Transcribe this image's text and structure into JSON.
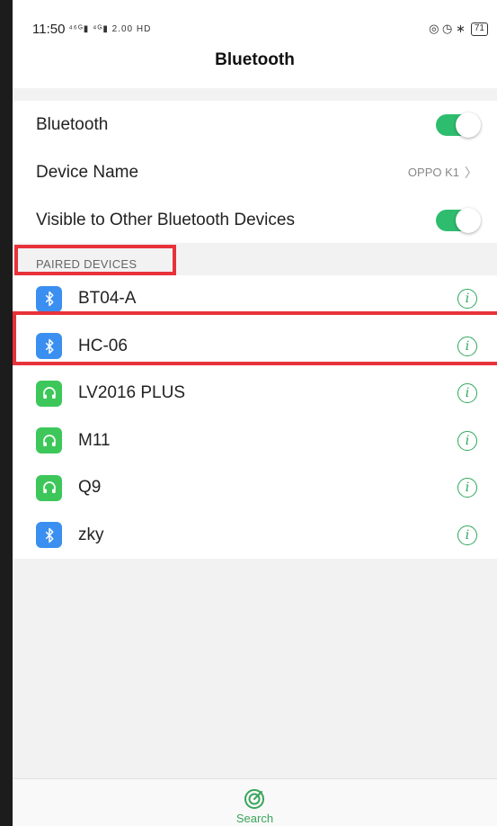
{
  "status_bar": {
    "time": "11:50",
    "signal_text": "⁴⁶ᴳ▮ ⁴ᴳ▮ 2.00 HD",
    "right_icons": "◎ ◷ ∗",
    "battery": "71"
  },
  "header": {
    "title": "Bluetooth"
  },
  "settings": {
    "bluetooth_label": "Bluetooth",
    "bluetooth_on": true,
    "device_name_label": "Device Name",
    "device_name_value": "OPPO K1",
    "visible_label": "Visible to Other Bluetooth Devices",
    "visible_on": true
  },
  "paired": {
    "section_label": "PAIRED DEVICES",
    "devices": [
      {
        "name": "BT04-A",
        "icon": "bluetooth-icon"
      },
      {
        "name": "HC-06",
        "icon": "bluetooth-icon"
      },
      {
        "name": "LV2016 PLUS",
        "icon": "headset-icon"
      },
      {
        "name": "M11",
        "icon": "headset-icon"
      },
      {
        "name": "Q9",
        "icon": "headset-icon"
      },
      {
        "name": "zky",
        "icon": "bluetooth-icon"
      }
    ]
  },
  "bottom_tab": {
    "search_label": "Search",
    "icon": "search-radar-icon"
  },
  "colors": {
    "accent_green": "#2ebd6e",
    "bluetooth_blue": "#3a8ff0",
    "headset_green": "#3dc75a",
    "highlight_red": "#e8323a"
  }
}
